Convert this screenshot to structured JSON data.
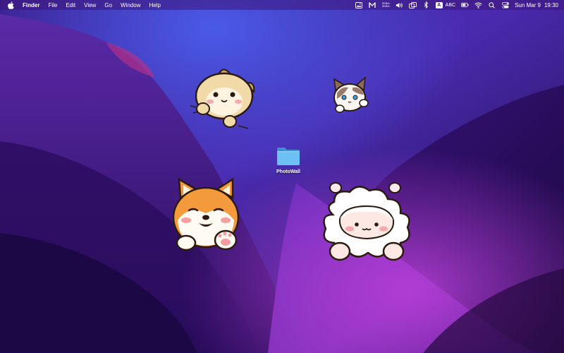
{
  "menubar": {
    "app_name": "Finder",
    "menus": [
      "File",
      "Edit",
      "View",
      "Go",
      "Window",
      "Help"
    ],
    "status": {
      "net_up": "0KB/s",
      "net_down": "0KB/s",
      "input_source_badge": "A",
      "input_source_label": "ABC",
      "date": "Sun Mar 9",
      "time": "19:30"
    },
    "icons": [
      "apple-icon",
      "photo-icon",
      "m-icon",
      "volume-icon",
      "bluetooth-icon",
      "screens-icon",
      "battery-icon",
      "wifi-icon",
      "search-icon",
      "control-center-icon"
    ]
  },
  "desktop": {
    "folder": {
      "label": "PhotoWall",
      "color": "#5ab4f0"
    },
    "stickers": [
      "hamster-sticker",
      "cat-sticker",
      "shiba-sticker",
      "sheep-sticker"
    ]
  },
  "colors": {
    "wallpaper_deep": "#1c0a45",
    "wallpaper_mid": "#4a1b9c",
    "wallpaper_accent": "#a23ad0",
    "wallpaper_blue": "#3a4ad8"
  }
}
